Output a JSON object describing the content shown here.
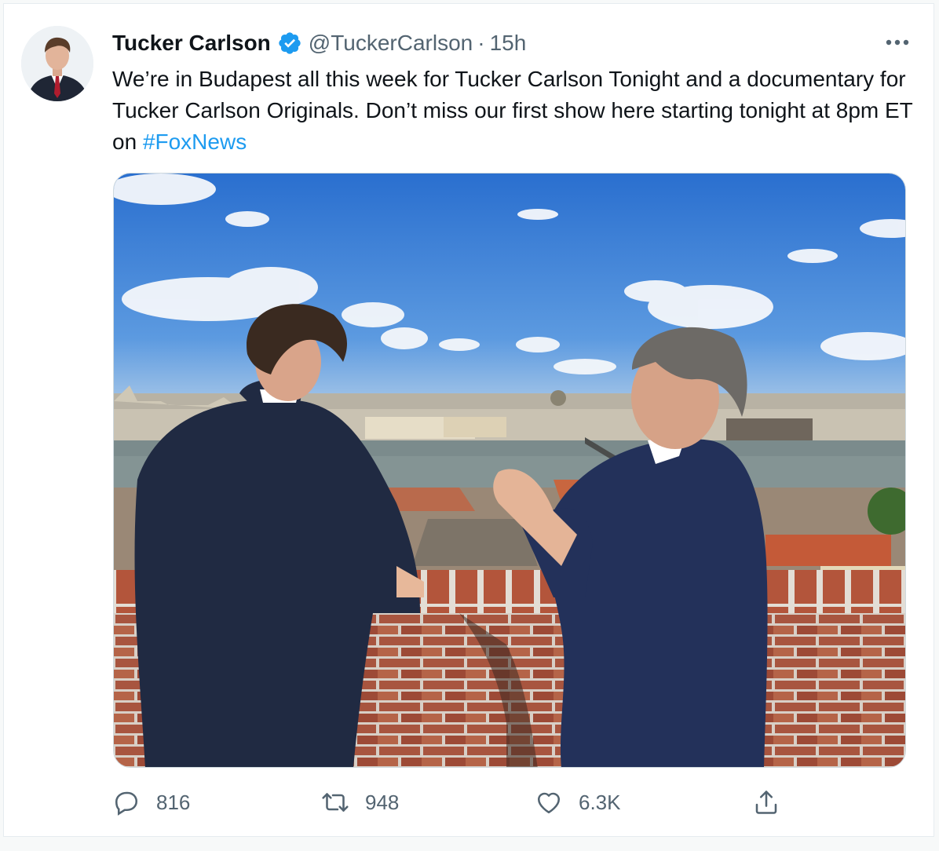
{
  "tweet": {
    "author_name": "Tucker Carlson",
    "author_handle": "@TuckerCarlson",
    "separator": "·",
    "time": "15h",
    "verified": true,
    "text_main": "We’re in Budapest all this week for Tucker Carlson Tonight and a documentary for Tucker Carlson Originals.  Don’t miss our first show here starting tonight at 8pm ET on ",
    "hashtag": "#FoxNews",
    "more_icon": "more-horizontal-icon"
  },
  "actions": {
    "reply_count": "816",
    "retweet_count": "948",
    "like_count": "6.3K",
    "reply_icon": "reply-icon",
    "retweet_icon": "retweet-icon",
    "like_icon": "heart-icon",
    "share_icon": "share-icon"
  },
  "colors": {
    "accent": "#1d9bf0",
    "secondary_text": "#536471",
    "primary_text": "#0f1419",
    "background": "#f7f9f9"
  }
}
